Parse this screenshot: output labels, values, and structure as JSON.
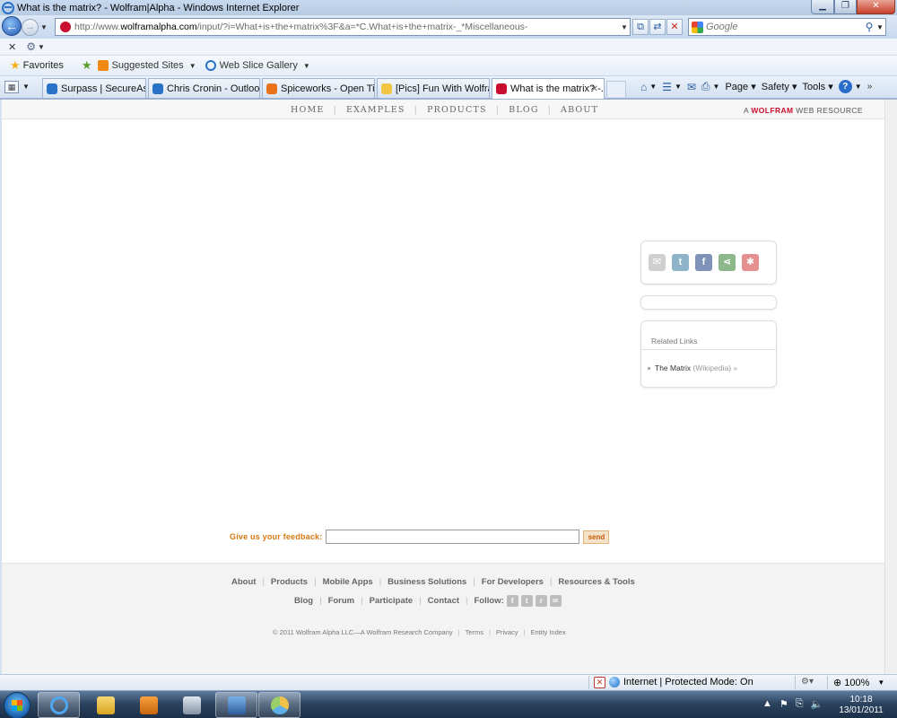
{
  "window": {
    "title": "What is the matrix? - Wolfram|Alpha - Windows Internet Explorer",
    "buttons": {
      "minimize": "▁",
      "maximize": "❐",
      "close": "✕"
    }
  },
  "navigation": {
    "url_prefix": "http://www.",
    "url_domain": "wolframalpha.com",
    "url_rest": "/input/?i=What+is+the+matrix%3F&a=*C.What+is+the+matrix-_*Miscellaneous-",
    "search_placeholder": "Google"
  },
  "favorites_bar": {
    "favorites_label": "Favorites",
    "suggested_sites": "Suggested Sites",
    "web_slice_gallery": "Web Slice Gallery"
  },
  "tabs": [
    {
      "label": "Surpass | SecureAssess",
      "icon": "ie-page-icon",
      "color": "#2a72c8"
    },
    {
      "label": "Chris Cronin - Outlook ...",
      "icon": "ie-page-icon",
      "color": "#2a72c8"
    },
    {
      "label": "Spiceworks - Open Tick...",
      "icon": "spiceworks-icon",
      "color": "#e8731b"
    },
    {
      "label": "[Pics] Fun With Wolfra...",
      "icon": "forum-icon",
      "color": "#f4c542"
    },
    {
      "label": "What is the matrix? -...",
      "icon": "wolfram-icon",
      "color": "#c8102e",
      "active": true
    }
  ],
  "command_bar": {
    "page": "Page",
    "safety": "Safety",
    "tools": "Tools"
  },
  "wolfram": {
    "menu": [
      "HOME",
      "EXAMPLES",
      "PRODUCTS",
      "BLOG",
      "ABOUT"
    ],
    "resource_prefix": "A",
    "resource_brand": "WOLFRAM",
    "resource_suffix": "WEB RESOURCE",
    "share_icons": [
      {
        "name": "email-share-icon",
        "glyph": "✉",
        "color": "#cfcfcf"
      },
      {
        "name": "twitter-share-icon",
        "glyph": "t",
        "color": "#8fb4c9"
      },
      {
        "name": "facebook-share-icon",
        "glyph": "f",
        "color": "#7f93b8"
      },
      {
        "name": "share-icon",
        "glyph": "⋖",
        "color": "#8cb88a"
      },
      {
        "name": "settings-share-icon",
        "glyph": "✱",
        "color": "#e59090"
      }
    ],
    "related_links_header": "Related Links",
    "related_link": "The Matrix",
    "related_link_source": "(Wikipedia) »",
    "feedback_label": "Give us your feedback:",
    "feedback_send": "send",
    "footer_row1": [
      "About",
      "Products",
      "Mobile Apps",
      "Business Solutions",
      "For Developers",
      "Resources & Tools"
    ],
    "footer_row2": [
      "Blog",
      "Forum",
      "Participate",
      "Contact"
    ],
    "follow_label": "Follow:",
    "copyright": "© 2011 Wolfram Alpha LLC—A Wolfram Research Company",
    "footer_row3": [
      "Terms",
      "Privacy",
      "Entity Index"
    ]
  },
  "status": {
    "zone": "Internet | Protected Mode: On",
    "zoom": "100%"
  },
  "taskbar": {
    "time": "10:18",
    "date": "13/01/2011"
  }
}
